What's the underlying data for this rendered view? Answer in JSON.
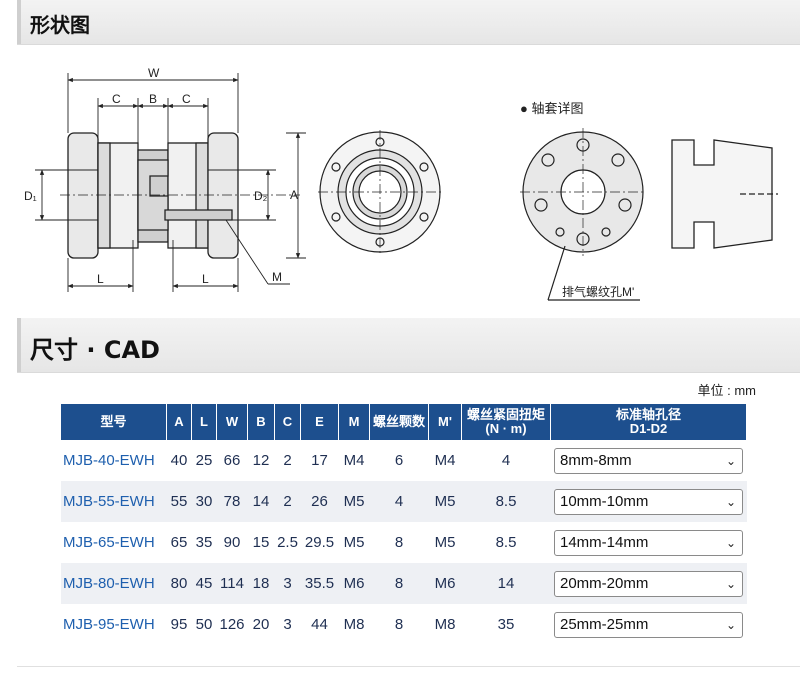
{
  "sections": {
    "shape_title": "形状图",
    "dimensions_title": "尺寸 · CAD"
  },
  "drawing": {
    "labels": {
      "W": "W",
      "C": "C",
      "B": "B",
      "L": "L",
      "A": "A",
      "M": "M"
    },
    "sleeve_detail_title": "● 轴套详图",
    "exhaust_label": "排气螺纹孔M'"
  },
  "unit_label": "单位 : mm",
  "table": {
    "headers": [
      "型号",
      "A",
      "L",
      "W",
      "B",
      "C",
      "E",
      "M",
      "螺丝颗数",
      "M'",
      "螺丝紧固扭矩\n(N · m)",
      "标准轴孔径\nD1-D2"
    ],
    "rows": [
      {
        "model": "MJB-40-EWH",
        "A": "40",
        "L": "25",
        "W": "66",
        "B": "12",
        "C": "2",
        "E": "17",
        "M": "M4",
        "count": "6",
        "Mp": "M4",
        "torque": "4",
        "bore": "8mm-8mm"
      },
      {
        "model": "MJB-55-EWH",
        "A": "55",
        "L": "30",
        "W": "78",
        "B": "14",
        "C": "2",
        "E": "26",
        "M": "M5",
        "count": "4",
        "Mp": "M5",
        "torque": "8.5",
        "bore": "10mm-10mm"
      },
      {
        "model": "MJB-65-EWH",
        "A": "65",
        "L": "35",
        "W": "90",
        "B": "15",
        "C": "2.5",
        "E": "29.5",
        "M": "M5",
        "count": "8",
        "Mp": "M5",
        "torque": "8.5",
        "bore": "14mm-14mm"
      },
      {
        "model": "MJB-80-EWH",
        "A": "80",
        "L": "45",
        "W": "114",
        "B": "18",
        "C": "3",
        "E": "35.5",
        "M": "M6",
        "count": "8",
        "Mp": "M6",
        "torque": "14",
        "bore": "20mm-20mm"
      },
      {
        "model": "MJB-95-EWH",
        "A": "95",
        "L": "50",
        "W": "126",
        "B": "20",
        "C": "3",
        "E": "44",
        "M": "M8",
        "count": "8",
        "Mp": "M8",
        "torque": "35",
        "bore": "25mm-25mm"
      }
    ]
  },
  "colors": {
    "header_bg": "#1d4f8e",
    "model_text": "#1e5fae",
    "alt_row": "#eef0f4"
  }
}
